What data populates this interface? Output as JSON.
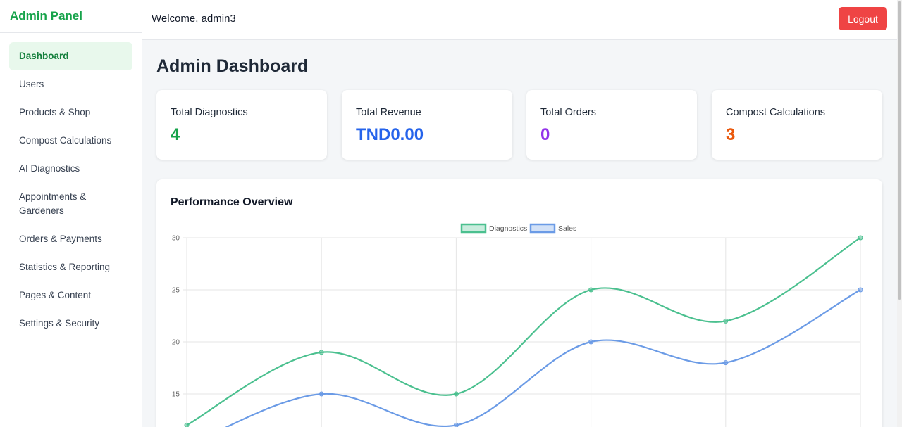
{
  "sidebar": {
    "brand": "Admin Panel",
    "items": [
      {
        "label": "Dashboard",
        "active": true
      },
      {
        "label": "Users"
      },
      {
        "label": "Products & Shop"
      },
      {
        "label": "Compost Calculations"
      },
      {
        "label": "AI Diagnostics"
      },
      {
        "label": "Appointments & Gardeners"
      },
      {
        "label": "Orders & Payments"
      },
      {
        "label": "Statistics & Reporting"
      },
      {
        "label": "Pages & Content"
      },
      {
        "label": "Settings & Security"
      }
    ]
  },
  "header": {
    "welcome": "Welcome, admin3",
    "logout_label": "Logout"
  },
  "main": {
    "title": "Admin Dashboard",
    "stats": [
      {
        "label": "Total Diagnostics",
        "value": "4",
        "color": "#16a34a"
      },
      {
        "label": "Total Revenue",
        "value": "TND0.00",
        "color": "#2563eb"
      },
      {
        "label": "Total Orders",
        "value": "0",
        "color": "#9333ea"
      },
      {
        "label": "Compost Calculations",
        "value": "3",
        "color": "#ea580c"
      }
    ],
    "chart_title": "Performance Overview"
  },
  "colors": {
    "accent": "#16a34a",
    "logout": "#ef4444",
    "diagnostics_line": "#4bc08f",
    "sales_line": "#6b9be6"
  },
  "chart_data": {
    "type": "line",
    "title": "Performance Overview",
    "xlabel": "",
    "ylabel": "",
    "legend": "top-center",
    "grid": true,
    "ylim_visible": [
      12,
      30
    ],
    "y_ticks": [
      15,
      20,
      25,
      30
    ],
    "series": [
      {
        "name": "Diagnostics",
        "color": "#4bc08f",
        "values": [
          12,
          19,
          15,
          25,
          22,
          30
        ]
      },
      {
        "name": "Sales",
        "color": "#6b9be6",
        "values": [
          10,
          15,
          12,
          20,
          18,
          25
        ]
      }
    ]
  }
}
